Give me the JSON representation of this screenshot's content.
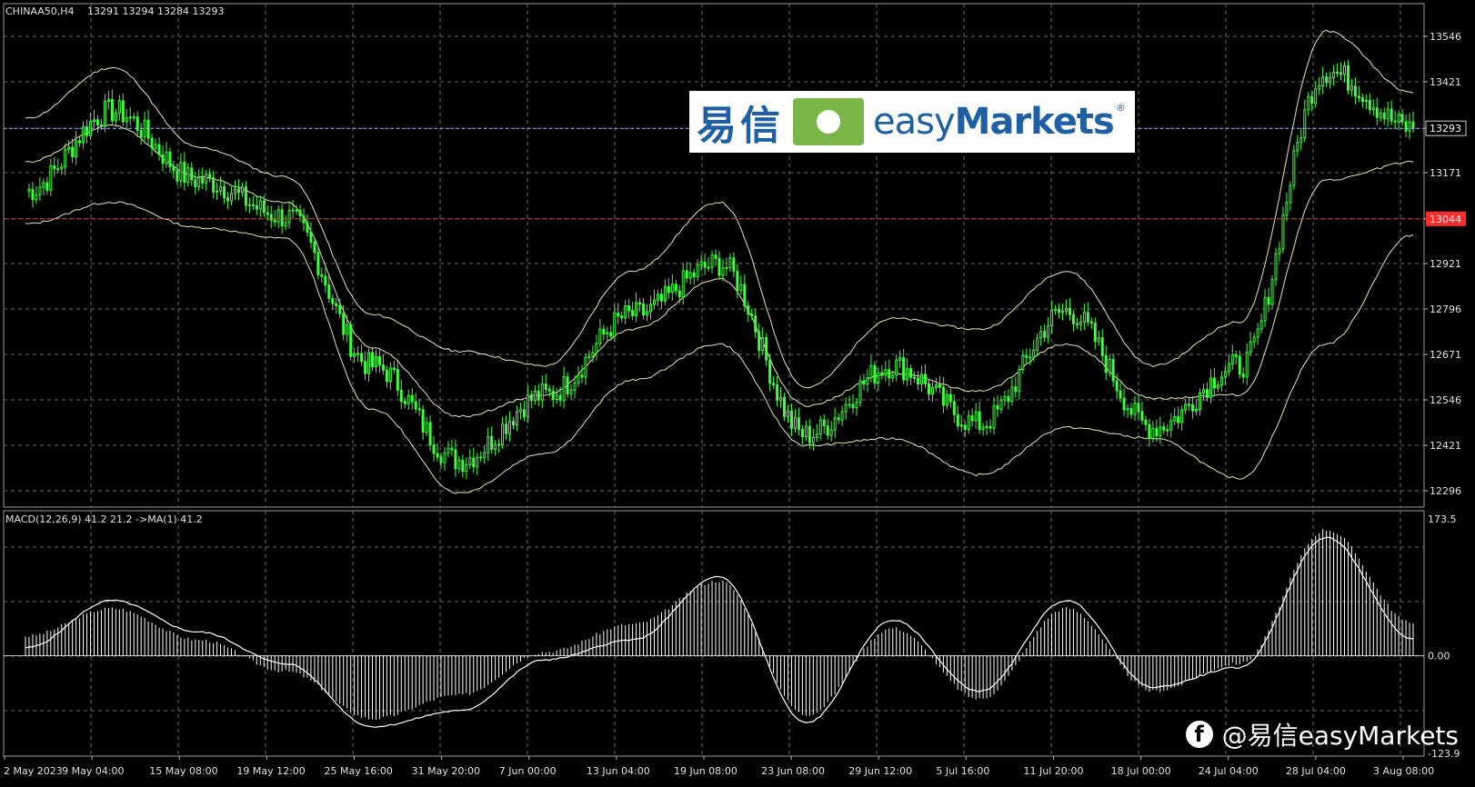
{
  "chart_header": {
    "symbol_info": "CHINAA50,H4",
    "ohlc": "13291 13294 13284 13293"
  },
  "indicator_header": "MACD(12,26,9) 41.2 21.2  ->MA(1) 41.2",
  "colors": {
    "background": "#000000",
    "grid": "#6b6b6b",
    "candles": "#3cff3c",
    "bollinger": "#e6e6b4",
    "price_line": "#8fb3ff",
    "alert_line": "#ff2a2a",
    "macd_hist": "#ffffff"
  },
  "price_axis": {
    "ticks": [
      "13546",
      "13421",
      "13293",
      "13171",
      "13044",
      "12921",
      "12796",
      "12671",
      "12546",
      "12421",
      "12296"
    ],
    "current_price_label": "13293",
    "alert_price_label": "13044"
  },
  "macd_axis": {
    "ticks": [
      "173.5",
      "0.00",
      "-123.9"
    ]
  },
  "time_axis": {
    "labels": [
      "2 May 2023",
      "9 May 04:00",
      "15 May 08:00",
      "19 May 12:00",
      "25 May 16:00",
      "31 May 20:00",
      "7 Jun 00:00",
      "13 Jun 04:00",
      "19 Jun 08:00",
      "23 Jun 08:00",
      "29 Jun 12:00",
      "5 Jul 16:00",
      "11 Jul 20:00",
      "18 Jul 00:00",
      "24 Jul 04:00",
      "28 Jul 04:00",
      "3 Aug 08:00"
    ]
  },
  "watermark": {
    "brand_cn": "易信",
    "brand_en_light": "easy",
    "brand_en_bold": "Markets",
    "registered": "®"
  },
  "social": {
    "handle": "@易信easyMarkets",
    "icon": "facebook-icon"
  },
  "chart_data": {
    "type": "line",
    "title": "CHINAA50,H4",
    "price_ylim": [
      12296,
      13546
    ],
    "macd_ylim": [
      -123.9,
      173.5
    ],
    "grid": true,
    "x": [
      "2 May 2023",
      "9 May 04:00",
      "15 May 08:00",
      "19 May 12:00",
      "25 May 16:00",
      "31 May 20:00",
      "7 Jun 00:00",
      "13 Jun 04:00",
      "19 Jun 08:00",
      "23 Jun 08:00",
      "29 Jun 12:00",
      "5 Jul 16:00",
      "11 Jul 20:00",
      "18 Jul 00:00",
      "24 Jul 04:00",
      "28 Jul 04:00",
      "3 Aug 08:00"
    ],
    "series": [
      {
        "name": "price",
        "values": [
          13120,
          13340,
          13150,
          13050,
          12640,
          12380,
          12560,
          12780,
          12920,
          12450,
          12640,
          12480,
          12790,
          12470,
          12640,
          13450,
          13293
        ]
      },
      {
        "name": "bollinger upper",
        "values": [
          13320,
          13460,
          13240,
          13160,
          12780,
          12680,
          12640,
          12900,
          13090,
          12580,
          12770,
          12740,
          12900,
          12640,
          12760,
          13560,
          13390
        ]
      },
      {
        "name": "bollinger middle",
        "values": [
          13200,
          13300,
          13160,
          13090,
          12690,
          12500,
          12560,
          12740,
          12880,
          12530,
          12620,
          12570,
          12700,
          12550,
          12560,
          13150,
          13200
        ]
      },
      {
        "name": "bollinger lower",
        "values": [
          13030,
          13090,
          13020,
          12990,
          12520,
          12290,
          12400,
          12600,
          12700,
          12420,
          12440,
          12340,
          12470,
          12440,
          12330,
          12700,
          13000
        ]
      },
      {
        "name": "MACD",
        "values": [
          25,
          60,
          20,
          -20,
          -80,
          -50,
          5,
          40,
          95,
          -75,
          35,
          -55,
          60,
          -45,
          -10,
          160,
          41.2
        ]
      },
      {
        "name": "signal",
        "values": [
          10,
          70,
          30,
          -10,
          -90,
          -70,
          -5,
          20,
          100,
          -85,
          45,
          -45,
          70,
          -40,
          -15,
          150,
          21.2
        ]
      }
    ]
  }
}
